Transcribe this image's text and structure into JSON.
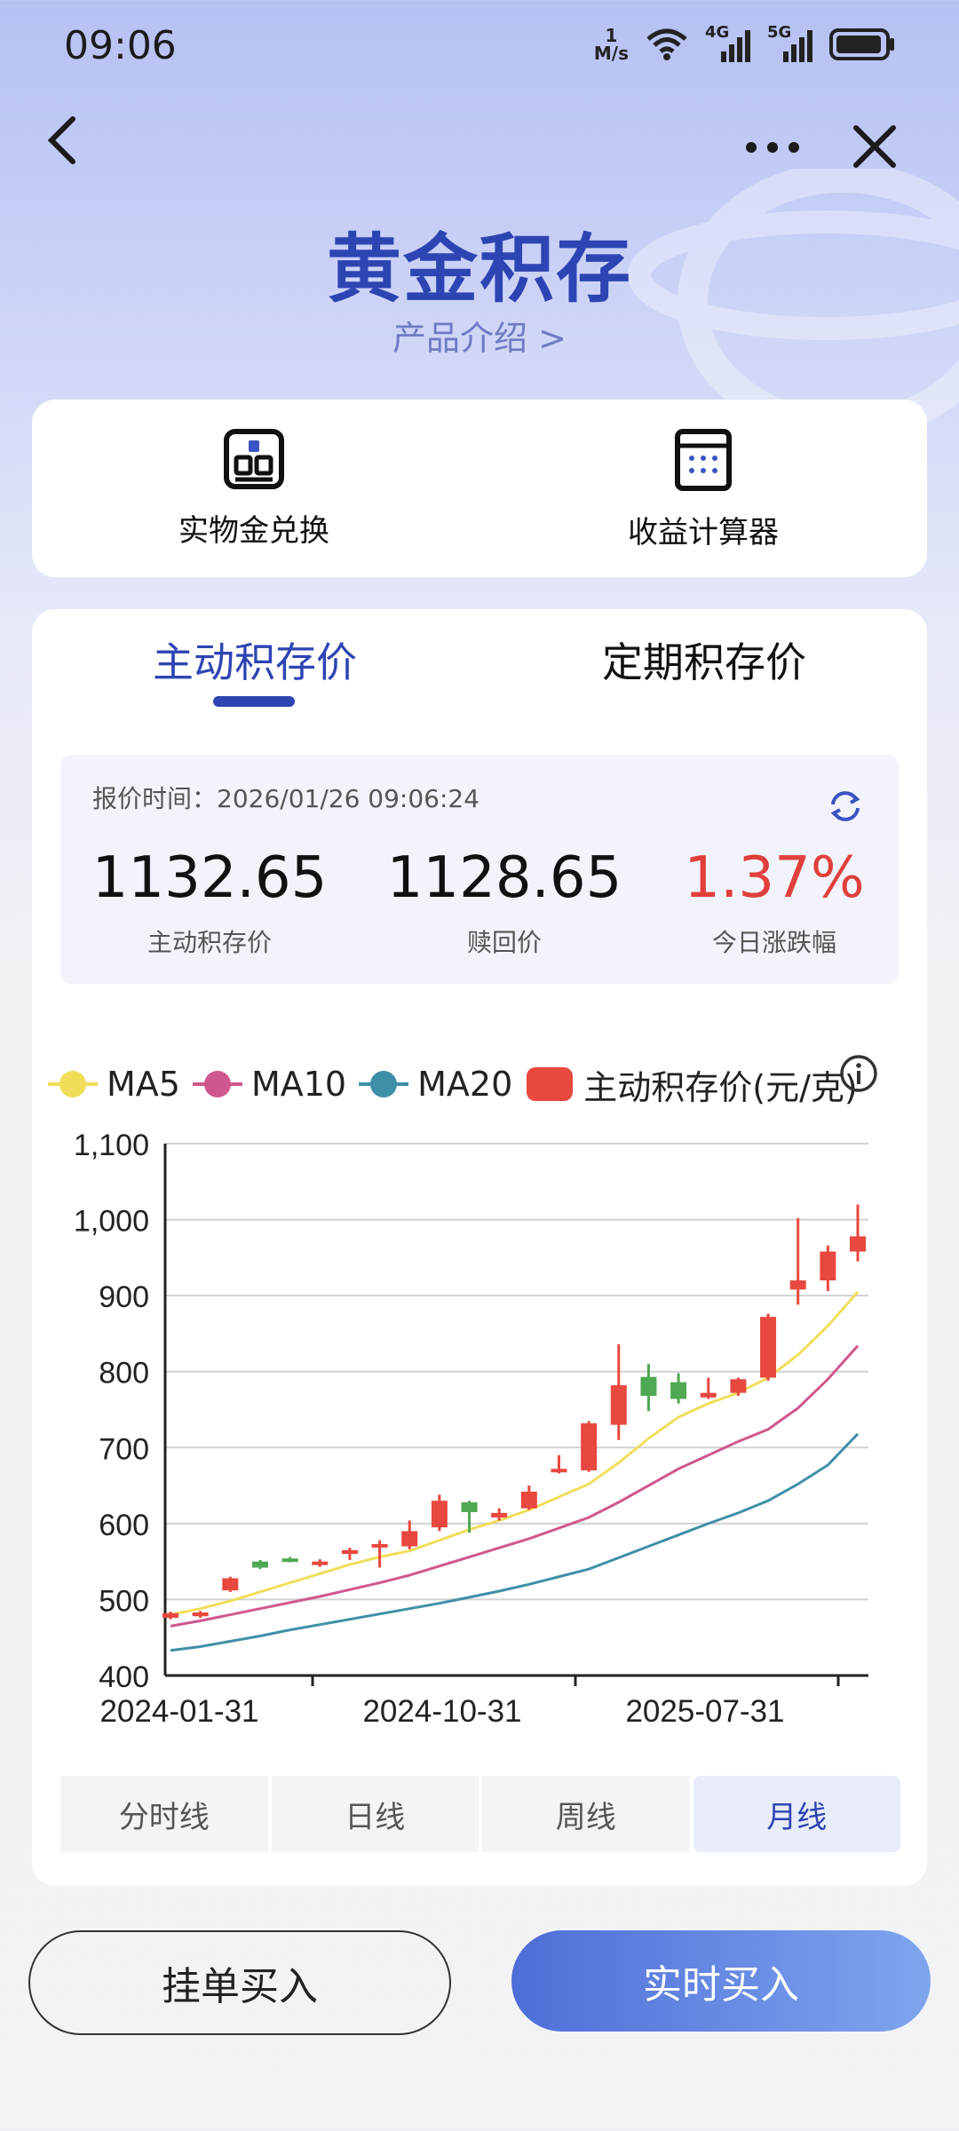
{
  "status_bar": {
    "time": "09:06",
    "net_speed_value": "1",
    "net_speed_unit": "M/s",
    "network_1": "4G",
    "network_2": "5G"
  },
  "header": {
    "title": "黄金积存",
    "subtitle": "产品介绍 >"
  },
  "quick_actions": [
    {
      "label": "实物金兑换",
      "icon": "gold-exchange-icon"
    },
    {
      "label": "收益计算器",
      "icon": "calculator-icon"
    }
  ],
  "tabs": {
    "active": "主动积存价",
    "inactive": "定期积存价"
  },
  "quote": {
    "time_label": "报价时间：2026/01/26 09:06:24",
    "items": [
      {
        "value": "1132.65",
        "label": "主动积存价"
      },
      {
        "value": "1128.65",
        "label": "赎回价"
      },
      {
        "value": "1.37%",
        "label": "今日涨跌幅"
      }
    ],
    "change_color": "#e0403c"
  },
  "legend": {
    "ma5": "MA5",
    "ma10": "MA10",
    "ma20": "MA20",
    "price": "主动积存价(元/克)"
  },
  "periods": {
    "p1": "分时线",
    "p2": "日线",
    "p3": "周线",
    "p4": "月线",
    "active": "月线"
  },
  "buttons": {
    "limit_buy": "挂单买入",
    "realtime_buy": "实时买入"
  },
  "colors": {
    "accent": "#2d44b3",
    "up": "#e8483f",
    "down": "#4fa852",
    "ma5": "#f0de5a",
    "ma10": "#d0578e",
    "ma20": "#3f8fa8"
  },
  "chart_data": {
    "type": "candlestick",
    "ylim": [
      400,
      1100
    ],
    "yticks": [
      "400",
      "500",
      "600",
      "700",
      "800",
      "900",
      "1,000",
      "1,100"
    ],
    "xtick_labels": [
      "2024-01-31",
      "2024-10-31",
      "2025-07-31"
    ],
    "grid": true,
    "legend_placement": "top",
    "candles": [
      {
        "open": 476,
        "close": 482,
        "high": 484,
        "low": 474
      },
      {
        "open": 478,
        "close": 483,
        "high": 485,
        "low": 476
      },
      {
        "open": 512,
        "close": 528,
        "high": 530,
        "low": 510
      },
      {
        "open": 550,
        "close": 542,
        "high": 552,
        "low": 540
      },
      {
        "open": 554,
        "close": 551,
        "high": 556,
        "low": 549
      },
      {
        "open": 546,
        "close": 550,
        "high": 553,
        "low": 543
      },
      {
        "open": 560,
        "close": 565,
        "high": 568,
        "low": 552
      },
      {
        "open": 570,
        "close": 573,
        "high": 578,
        "low": 542
      },
      {
        "open": 570,
        "close": 590,
        "high": 604,
        "low": 566
      },
      {
        "open": 595,
        "close": 630,
        "high": 638,
        "low": 590
      },
      {
        "open": 628,
        "close": 615,
        "high": 630,
        "low": 588
      },
      {
        "open": 608,
        "close": 614,
        "high": 620,
        "low": 604
      },
      {
        "open": 620,
        "close": 642,
        "high": 650,
        "low": 618
      },
      {
        "open": 668,
        "close": 672,
        "high": 690,
        "low": 666
      },
      {
        "open": 670,
        "close": 732,
        "high": 735,
        "low": 668
      },
      {
        "open": 730,
        "close": 782,
        "high": 836,
        "low": 710
      },
      {
        "open": 793,
        "close": 768,
        "high": 810,
        "low": 748
      },
      {
        "open": 786,
        "close": 764,
        "high": 798,
        "low": 758
      },
      {
        "open": 766,
        "close": 772,
        "high": 792,
        "low": 764
      },
      {
        "open": 772,
        "close": 790,
        "high": 792,
        "low": 768
      },
      {
        "open": 792,
        "close": 872,
        "high": 876,
        "low": 788
      },
      {
        "open": 908,
        "close": 920,
        "high": 1002,
        "low": 888
      },
      {
        "open": 920,
        "close": 958,
        "high": 966,
        "low": 906
      },
      {
        "open": 958,
        "close": 978,
        "high": 1020,
        "low": 945
      }
    ],
    "ma5": [
      480,
      488,
      498,
      510,
      522,
      534,
      546,
      556,
      564,
      578,
      592,
      604,
      618,
      635,
      652,
      680,
      712,
      740,
      758,
      772,
      792,
      822,
      860,
      905
    ],
    "ma10": [
      465,
      472,
      480,
      488,
      496,
      504,
      513,
      522,
      532,
      544,
      556,
      568,
      580,
      594,
      608,
      628,
      650,
      672,
      690,
      708,
      724,
      752,
      790,
      834
    ],
    "ma20": [
      433,
      438,
      445,
      452,
      460,
      467,
      474,
      481,
      488,
      495,
      503,
      511,
      520,
      530,
      540,
      555,
      570,
      585,
      600,
      614,
      630,
      652,
      677,
      718
    ]
  }
}
